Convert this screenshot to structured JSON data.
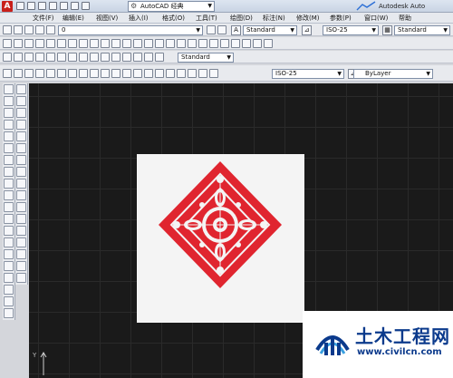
{
  "titlebar": {
    "workspace": "AutoCAD 经典",
    "app_title": "Autodesk Auto"
  },
  "menu": [
    "文件(F)",
    "编辑(E)",
    "视图(V)",
    "插入(I)",
    "格式(O)",
    "工具(T)",
    "绘图(D)",
    "标注(N)",
    "修改(M)",
    "参数(P)",
    "窗口(W)",
    "帮助"
  ],
  "toolbar": {
    "layer_value": "0",
    "text_style": "Standard",
    "dim_style": "ISO-25",
    "table_style": "Standard",
    "dim_style_2": "ISO-25",
    "layer_select": "ByLayer"
  },
  "canvas": {
    "ucs_y": "Y"
  },
  "watermark": {
    "title": "土木工程网",
    "url": "www.civilcn.com"
  },
  "colors": {
    "pattern": "#e0252f",
    "brand_blue": "#0b3a8c"
  }
}
